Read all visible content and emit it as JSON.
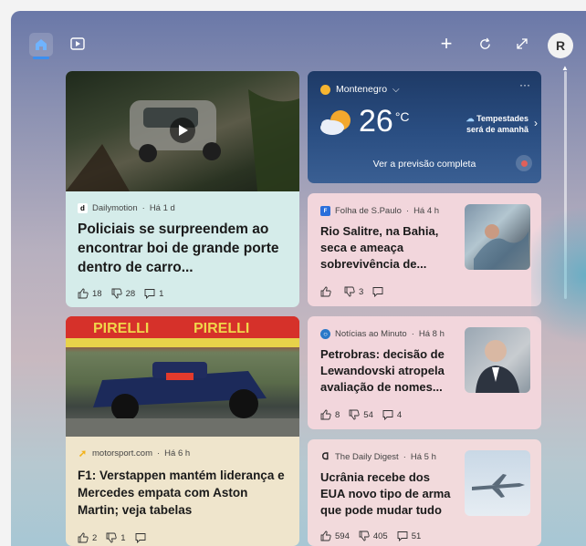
{
  "topbar": {
    "icons": [
      "home-icon",
      "video-icon",
      "plus-icon",
      "refresh-icon",
      "expand-icon"
    ],
    "avatar_initial": "R"
  },
  "weather": {
    "location": "Montenegro",
    "temperature": "26",
    "unit": "°C",
    "alert_line1": "Tempestades",
    "alert_line2": "será de amanhã",
    "forecast_link": "Ver a previsão completa",
    "more": "···"
  },
  "cards": [
    {
      "source": "Dailymotion",
      "time": "Há 1 d",
      "title": "Policiais se surpreendem ao encontrar boi de grande porte dentro de carro...",
      "likes": "18",
      "dislikes": "28",
      "comments": "1"
    },
    {
      "source": "Folha de S.Paulo",
      "time": "Há 4 h",
      "title": "Rio Salitre, na Bahia, seca e ameaça sobrevivência de...",
      "likes": "",
      "dislikes": "3",
      "comments": ""
    },
    {
      "source": "Notícias ao Minuto",
      "time": "Há 8 h",
      "title": "Petrobras: decisão de Lewandovski atropela avaliação de nomes...",
      "likes": "8",
      "dislikes": "54",
      "comments": "4"
    },
    {
      "source": "motorsport.com",
      "time": "Há 6 h",
      "title": "F1: Verstappen mantém liderança e Mercedes empata com Aston Martin; veja tabelas",
      "likes": "2",
      "dislikes": "1",
      "comments": ""
    },
    {
      "source": "The Daily Digest",
      "time": "Há 5 h",
      "title": "Ucrânia recebe dos EUA novo tipo de arma que pode mudar tudo",
      "likes": "594",
      "dislikes": "405",
      "comments": "51"
    }
  ],
  "colors": {
    "card1_bg": "#d5ecea",
    "card2_bg": "#f2d6dc",
    "card3_bg": "#f2d6dc",
    "card4_bg": "#efe5cc",
    "card5_bg": "#f2dadc",
    "accent": "#3b8ff0"
  }
}
